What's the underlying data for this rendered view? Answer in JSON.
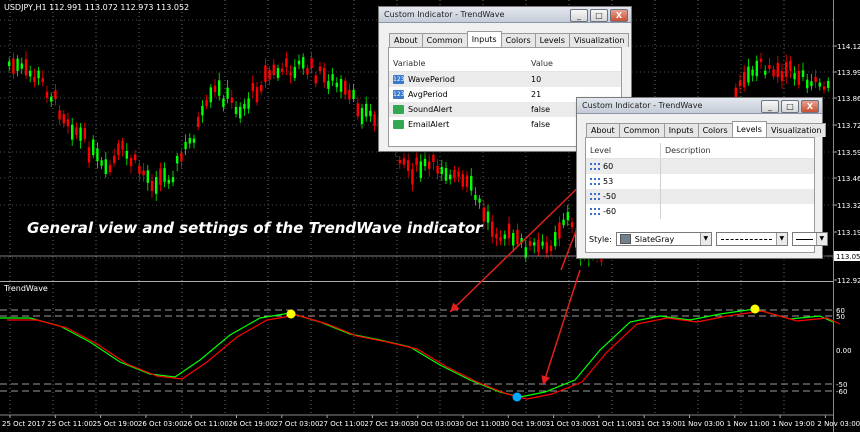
{
  "window": {
    "symbol_label": "USDJPY,H1  112.991 113.072 112.973 113.052",
    "current_price": "113.052",
    "price_scale": [
      "114.125",
      "113.990",
      "113.860",
      "113.725",
      "113.595",
      "113.460",
      "113.325",
      "113.190",
      "112.920"
    ],
    "indicator_name": "TrendWave",
    "indicator_scale": [
      "60",
      "50",
      "0.00",
      "-50",
      "-60"
    ],
    "time_axis": [
      "25 Oct 2017",
      "25 Oct 11:00",
      "25 Oct 19:00",
      "26 Oct 03:00",
      "26 Oct 11:00",
      "26 Oct 19:00",
      "27 Oct 03:00",
      "27 Oct 11:00",
      "27 Oct 19:00",
      "30 Oct 03:00",
      "30 Oct 11:00",
      "30 Oct 19:00",
      "31 Oct 03:00",
      "31 Oct 11:00",
      "31 Oct 19:00",
      "1 Nov 03:00",
      "1 Nov 11:00",
      "1 Nov 19:00",
      "2 Nov 03:00"
    ]
  },
  "caption": "General view and settings of the TrendWave indicator",
  "colors": {
    "bull": "#00ff00",
    "bear": "#ff0000",
    "fast_line": "#00ff00",
    "slow_line": "#ff0000",
    "marker_top": "#ffff00",
    "marker_bottom": "#00aaff",
    "arrow": "#e0201c"
  },
  "dialog_inputs": {
    "title": "Custom Indicator - TrendWave",
    "minimize": "_",
    "maximize": "□",
    "close": "X",
    "tabs": [
      "About",
      "Common",
      "Inputs",
      "Colors",
      "Levels",
      "Visualization"
    ],
    "active_tab": "Inputs",
    "columns": [
      "Variable",
      "Value"
    ],
    "rows": [
      {
        "variable": "WavePeriod",
        "value": "10",
        "icon": "variable-icon"
      },
      {
        "variable": "AvgPeriod",
        "value": "21",
        "icon": "variable-icon"
      },
      {
        "variable": "SoundAlert",
        "value": "false",
        "icon": "boolean-icon"
      },
      {
        "variable": "EmailAlert",
        "value": "false",
        "icon": "boolean-icon"
      }
    ],
    "var_icon_text": "123"
  },
  "dialog_levels": {
    "title": "Custom Indicator - TrendWave",
    "minimize": "_",
    "maximize": "□",
    "close": "X",
    "tabs": [
      "About",
      "Common",
      "Inputs",
      "Colors",
      "Levels",
      "Visualization"
    ],
    "active_tab": "Levels",
    "columns": [
      "Level",
      "Description"
    ],
    "rows": [
      {
        "level": "60"
      },
      {
        "level": "53"
      },
      {
        "level": "-50"
      },
      {
        "level": "-60"
      }
    ],
    "style_label": "Style:",
    "style_color": "SlateGray"
  }
}
